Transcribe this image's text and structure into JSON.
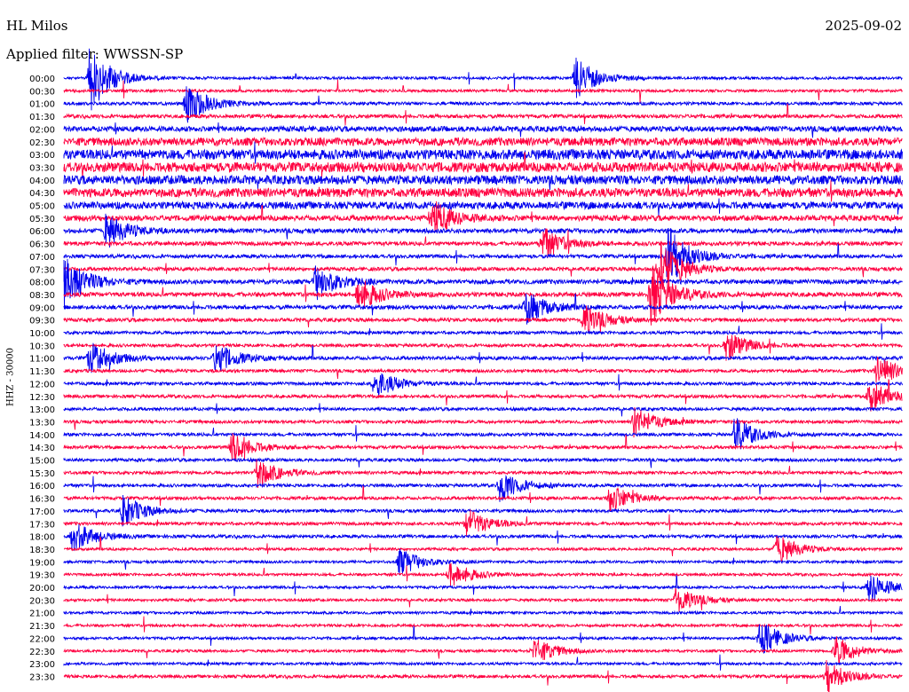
{
  "header": {
    "station": "HL Milos",
    "date": "2025-09-02",
    "filter": "Applied filter: WWSSN-SP",
    "channel": "HHZ - 30000"
  },
  "colors": {
    "trace_a": "#0000ee",
    "trace_b": "#ff0040",
    "background": "#ffffff"
  },
  "chart_data": {
    "type": "line",
    "title": "HL Milos",
    "ylabel": "HHZ - 30000",
    "grid": false,
    "row_labels": [
      "00:00",
      "00:30",
      "01:00",
      "01:30",
      "02:00",
      "02:30",
      "03:00",
      "03:30",
      "04:00",
      "04:30",
      "05:00",
      "05:30",
      "06:00",
      "06:30",
      "07:00",
      "07:30",
      "08:00",
      "08:30",
      "09:00",
      "09:30",
      "10:00",
      "10:30",
      "11:00",
      "11:30",
      "12:00",
      "12:30",
      "13:00",
      "13:30",
      "14:00",
      "14:30",
      "15:00",
      "15:30",
      "16:00",
      "16:30",
      "17:00",
      "17:30",
      "18:00",
      "18:30",
      "19:00",
      "19:30",
      "20:00",
      "20:30",
      "21:00",
      "21:30",
      "22:00",
      "22:30",
      "23:00",
      "23:30"
    ],
    "row_colors": [
      "blue",
      "red"
    ],
    "row_noise_level": [
      0.3,
      0.3,
      0.35,
      0.4,
      0.6,
      0.9,
      1.1,
      1.1,
      1.0,
      1.0,
      0.8,
      0.6,
      0.5,
      0.45,
      0.4,
      0.4,
      0.5,
      0.5,
      0.45,
      0.4,
      0.35,
      0.35,
      0.4,
      0.35,
      0.35,
      0.35,
      0.35,
      0.35,
      0.35,
      0.35,
      0.35,
      0.35,
      0.35,
      0.35,
      0.35,
      0.35,
      0.35,
      0.3,
      0.3,
      0.3,
      0.3,
      0.3,
      0.3,
      0.3,
      0.3,
      0.3,
      0.3,
      0.35
    ],
    "events": [
      {
        "row": 0,
        "pos": 0.03,
        "amp": 4.0
      },
      {
        "row": 0,
        "pos": 0.61,
        "amp": 2.5
      },
      {
        "row": 2,
        "pos": 0.145,
        "amp": 2.5
      },
      {
        "row": 11,
        "pos": 0.44,
        "amp": 2.0
      },
      {
        "row": 12,
        "pos": 0.05,
        "amp": 2.0
      },
      {
        "row": 13,
        "pos": 0.57,
        "amp": 2.0
      },
      {
        "row": 14,
        "pos": 0.72,
        "amp": 3.5
      },
      {
        "row": 15,
        "pos": 0.71,
        "amp": 3.5
      },
      {
        "row": 16,
        "pos": 0.0,
        "amp": 3.0
      },
      {
        "row": 16,
        "pos": 0.3,
        "amp": 2.0
      },
      {
        "row": 17,
        "pos": 0.7,
        "amp": 3.5
      },
      {
        "row": 17,
        "pos": 0.35,
        "amp": 2.0
      },
      {
        "row": 18,
        "pos": 0.55,
        "amp": 2.0
      },
      {
        "row": 19,
        "pos": 0.62,
        "amp": 1.8
      },
      {
        "row": 21,
        "pos": 0.79,
        "amp": 1.8
      },
      {
        "row": 22,
        "pos": 0.03,
        "amp": 2.0
      },
      {
        "row": 22,
        "pos": 0.18,
        "amp": 1.8
      },
      {
        "row": 23,
        "pos": 0.97,
        "amp": 1.8
      },
      {
        "row": 24,
        "pos": 0.37,
        "amp": 1.8
      },
      {
        "row": 25,
        "pos": 0.96,
        "amp": 1.8
      },
      {
        "row": 27,
        "pos": 0.68,
        "amp": 1.8
      },
      {
        "row": 28,
        "pos": 0.8,
        "amp": 2.0
      },
      {
        "row": 29,
        "pos": 0.2,
        "amp": 1.8
      },
      {
        "row": 31,
        "pos": 0.23,
        "amp": 1.8
      },
      {
        "row": 32,
        "pos": 0.52,
        "amp": 1.8
      },
      {
        "row": 33,
        "pos": 0.65,
        "amp": 1.8
      },
      {
        "row": 34,
        "pos": 0.07,
        "amp": 1.8
      },
      {
        "row": 35,
        "pos": 0.48,
        "amp": 1.8
      },
      {
        "row": 36,
        "pos": 0.01,
        "amp": 1.8
      },
      {
        "row": 37,
        "pos": 0.85,
        "amp": 1.8
      },
      {
        "row": 38,
        "pos": 0.4,
        "amp": 1.6
      },
      {
        "row": 39,
        "pos": 0.46,
        "amp": 1.6
      },
      {
        "row": 40,
        "pos": 0.96,
        "amp": 1.8
      },
      {
        "row": 41,
        "pos": 0.73,
        "amp": 1.6
      },
      {
        "row": 44,
        "pos": 0.83,
        "amp": 2.0
      },
      {
        "row": 45,
        "pos": 0.92,
        "amp": 1.8
      },
      {
        "row": 45,
        "pos": 0.56,
        "amp": 1.6
      },
      {
        "row": 47,
        "pos": 0.91,
        "amp": 1.8
      }
    ]
  }
}
